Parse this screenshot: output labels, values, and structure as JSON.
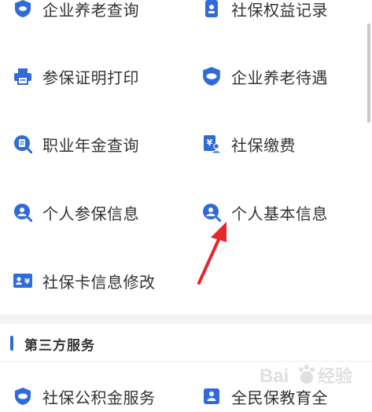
{
  "services": {
    "row1_left": {
      "label": "企业养老查询",
      "icon": "shield-check-icon"
    },
    "row1_right": {
      "label": "社保权益记录",
      "icon": "id-badge-icon"
    },
    "row2_left": {
      "label": "参保证明打印",
      "icon": "printer-icon"
    },
    "row2_right": {
      "label": "企业养老待遇",
      "icon": "shield-icon"
    },
    "row3_left": {
      "label": "职业年金查询",
      "icon": "document-search-icon"
    },
    "row3_right": {
      "label": "社保缴费",
      "icon": "payment-person-icon"
    },
    "row4_left": {
      "label": "个人参保信息",
      "icon": "person-search-icon"
    },
    "row4_right": {
      "label": "个人基本信息",
      "icon": "person-search-icon"
    },
    "row5_left": {
      "label": "社保卡信息修改",
      "icon": "card-yuan-icon"
    }
  },
  "third_party": {
    "title": "第三方服务",
    "items": [
      {
        "label": "社保公积金服务",
        "icon": "shield-icon"
      },
      {
        "label": "全民保教育全",
        "icon": "person-card-icon"
      }
    ]
  },
  "colors": {
    "accent": "#2f6bd9",
    "annotation_arrow": "#e5262b"
  }
}
